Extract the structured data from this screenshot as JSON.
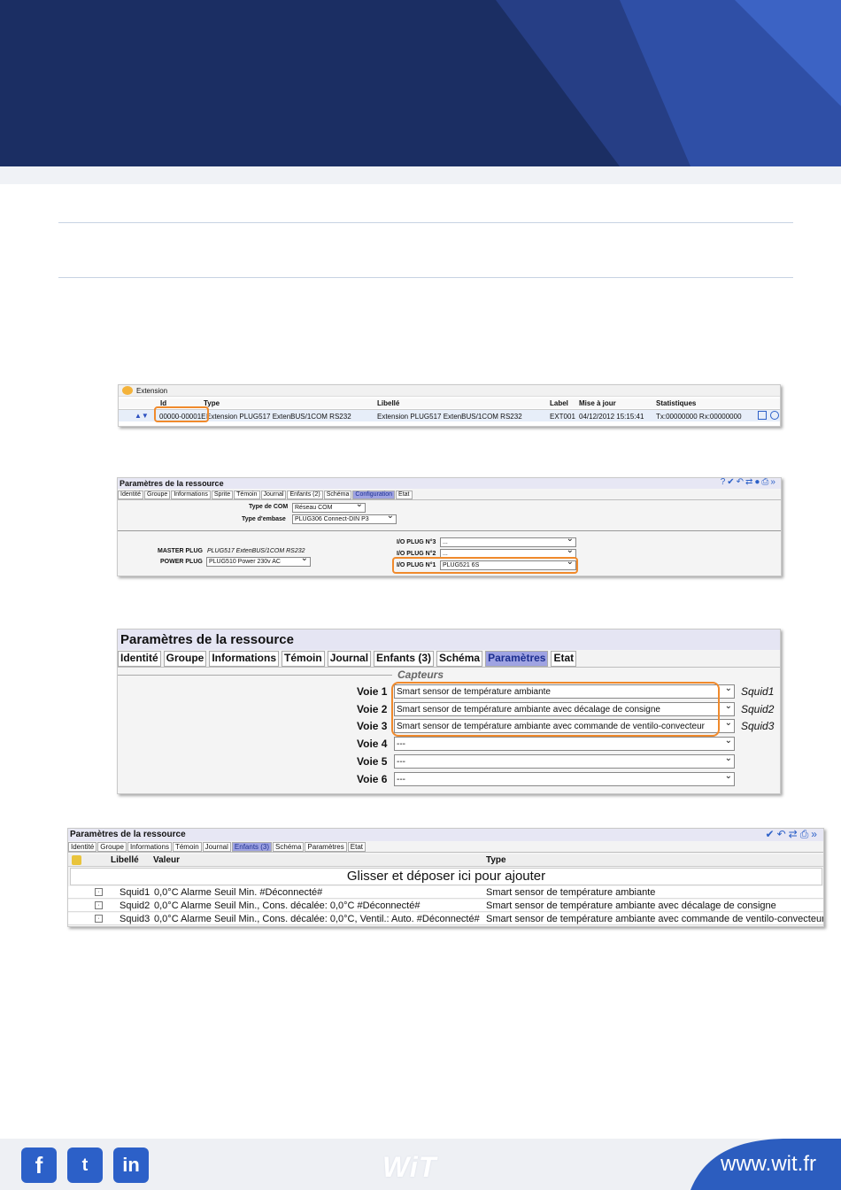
{
  "shot1": {
    "title": "Extension",
    "headers": [
      "Id",
      "Type",
      "Libellé",
      "Label",
      "Mise à jour",
      "Statistiques"
    ],
    "row": {
      "id": "00000-00001E",
      "type": "Extension PLUG517 ExtenBUS/1COM RS232",
      "libelle": "Extension PLUG517 ExtenBUS/1COM RS232",
      "label": "EXT001",
      "maj": "04/12/2012 15:15:41",
      "stats": "Tx:00000000 Rx:00000000"
    }
  },
  "shot2": {
    "title": "Paramètres de la ressource",
    "tabs": [
      "Identité",
      "Groupe",
      "Informations",
      "Sprite",
      "Témoin",
      "Journal",
      "Enfants (2)",
      "Schéma",
      "Configuration",
      "Etat"
    ],
    "type_com_label": "Type de COM",
    "type_com_value": "Réseau COM",
    "embase_label": "Type d'embase",
    "embase_value": "PLUG306 Connect-DIN P3",
    "master_label": "MASTER PLUG",
    "master_value": "PLUG517 ExtenBUS/1COM RS232",
    "power_label": "POWER PLUG",
    "power_value": "PLUG510 Power 230v AC",
    "io3_label": "I/O PLUG N°3",
    "io3_value": "...",
    "io2_label": "I/O PLUG N°2",
    "io2_value": "...",
    "io1_label": "I/O PLUG N°1",
    "io1_value": "PLUG521 6S"
  },
  "shot3": {
    "title": "Paramètres de la ressource",
    "tabs": [
      "Identité",
      "Groupe",
      "Informations",
      "Témoin",
      "Journal",
      "Enfants (3)",
      "Schéma",
      "Paramètres",
      "Etat"
    ],
    "section": "Capteurs",
    "voies": [
      {
        "label": "Voie 1",
        "value": "Smart sensor de température ambiante",
        "squid": "Squid1"
      },
      {
        "label": "Voie 2",
        "value": "Smart sensor de température ambiante avec décalage de consigne",
        "squid": "Squid2"
      },
      {
        "label": "Voie 3",
        "value": "Smart sensor de température ambiante avec commande de ventilo-convecteur",
        "squid": "Squid3"
      },
      {
        "label": "Voie 4",
        "value": "---",
        "squid": ""
      },
      {
        "label": "Voie 5",
        "value": "---",
        "squid": ""
      },
      {
        "label": "Voie 6",
        "value": "---",
        "squid": ""
      }
    ]
  },
  "shot4": {
    "title": "Paramètres de la ressource",
    "tabs": [
      "Identité",
      "Groupe",
      "Informations",
      "Témoin",
      "Journal",
      "Enfants (3)",
      "Schéma",
      "Paramètres",
      "Etat"
    ],
    "headers": [
      "Libellé",
      "Valeur",
      "Type"
    ],
    "drop_text": "Glisser et déposer ici pour ajouter",
    "rows": [
      {
        "libelle": "Squid1",
        "valeur": "0,0°C Alarme Seuil Min.  #Déconnecté#",
        "type": "Smart sensor de température ambiante"
      },
      {
        "libelle": "Squid2",
        "valeur": "0,0°C Alarme Seuil Min., Cons. décalée: 0,0°C  #Déconnecté#",
        "type": "Smart sensor de température ambiante avec décalage de consigne"
      },
      {
        "libelle": "Squid3",
        "valeur": "0,0°C Alarme Seuil Min., Cons. décalée: 0,0°C, Ventil.: Auto.  #Déconnecté#",
        "type": "Smart sensor de température ambiante avec commande de ventilo-convecteur"
      }
    ]
  },
  "footer": {
    "brand": "WiT",
    "url": "www.wit.fr",
    "social": [
      "f",
      "t",
      "in"
    ]
  },
  "colors": {
    "banner": "#1c2f66",
    "accent_blue": "#2c60c8",
    "highlight": "#f08a2c",
    "active_tab": "#9fa3e2"
  }
}
